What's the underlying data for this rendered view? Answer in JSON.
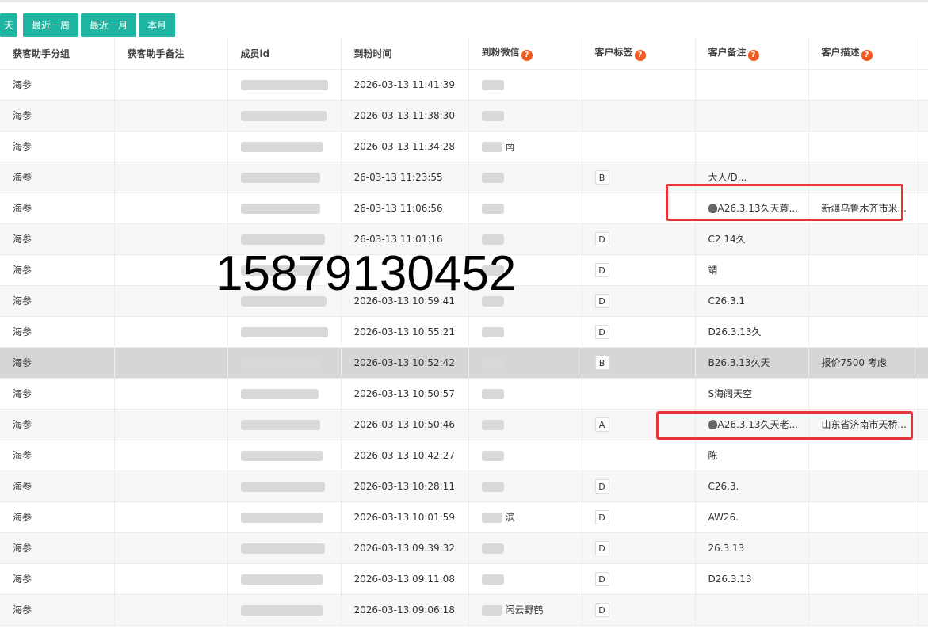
{
  "quick_buttons": [
    "天",
    "最近一周",
    "最近一月",
    "本月"
  ],
  "columns": [
    "获客助手分组",
    "获客助手备注",
    "成员id",
    "到粉时间",
    "到粉微信",
    "客户标签",
    "客户备注",
    "客户描述"
  ],
  "help_icon_glyph": "?",
  "overlay_number": "15879130452",
  "accent_color": "#1fb5a3",
  "highlight_box_color": "#e5343a",
  "rows": [
    {
      "group": "海参",
      "time": "2026-03-13 11:41:39",
      "wechat": "",
      "tag": "",
      "remark": "",
      "desc": ""
    },
    {
      "group": "海参",
      "time": "2026-03-13 11:38:30",
      "wechat": "",
      "tag": "",
      "remark": "",
      "desc": ""
    },
    {
      "group": "海参",
      "time": "2026-03-13 11:34:28",
      "wechat": "南",
      "tag": "",
      "remark": "",
      "desc": ""
    },
    {
      "group": "海参",
      "time": "26-03-13 11:23:55",
      "wechat": "",
      "tag": "B",
      "remark": "大人/D...",
      "desc": ""
    },
    {
      "group": "海参",
      "time": "26-03-13 11:06:56",
      "wechat": "",
      "tag": "",
      "remark": "A26.3.13久天蓑...",
      "desc": "新疆乌鲁木齐市米..."
    },
    {
      "group": "海参",
      "time": "26-03-13 11:01:16",
      "wechat": "",
      "tag": "D",
      "remark": "C2 14久",
      "desc": ""
    },
    {
      "group": "海参",
      "time": "",
      "wechat": "",
      "tag": "D",
      "remark": "靖",
      "desc": ""
    },
    {
      "group": "海参",
      "time": "2026-03-13 10:59:41",
      "wechat": "",
      "tag": "D",
      "remark": "C26.3.1",
      "desc": ""
    },
    {
      "group": "海参",
      "time": "2026-03-13 10:55:21",
      "wechat": "",
      "tag": "D",
      "remark": "D26.3.13久",
      "desc": ""
    },
    {
      "group": "海参",
      "time": "2026-03-13 10:52:42",
      "wechat": "",
      "tag": "B",
      "remark": "B26.3.13久天",
      "desc": "报价7500 考虑"
    },
    {
      "group": "海参",
      "time": "2026-03-13 10:50:57",
      "wechat": "",
      "tag": "",
      "remark": "S海阔天空",
      "desc": ""
    },
    {
      "group": "海参",
      "time": "2026-03-13 10:50:46",
      "wechat": "",
      "tag": "A",
      "remark": "A26.3.13久天老...",
      "desc": "山东省济南市天桥..."
    },
    {
      "group": "海参",
      "time": "2026-03-13 10:42:27",
      "wechat": "",
      "tag": "",
      "remark": "陈",
      "desc": ""
    },
    {
      "group": "海参",
      "time": "2026-03-13 10:28:11",
      "wechat": "",
      "tag": "D",
      "remark": "C26.3.",
      "desc": ""
    },
    {
      "group": "海参",
      "time": "2026-03-13 10:01:59",
      "wechat": "滨",
      "tag": "D",
      "remark": "AW26.",
      "desc": ""
    },
    {
      "group": "海参",
      "time": "2026-03-13 09:39:32",
      "wechat": "",
      "tag": "D",
      "remark": "26.3.13",
      "desc": ""
    },
    {
      "group": "海参",
      "time": "2026-03-13 09:11:08",
      "wechat": "",
      "tag": "D",
      "remark": "D26.3.13",
      "desc": ""
    },
    {
      "group": "海参",
      "time": "2026-03-13 09:06:18",
      "wechat": "闲云野鹤",
      "tag": "D",
      "remark": "",
      "desc": ""
    }
  ]
}
